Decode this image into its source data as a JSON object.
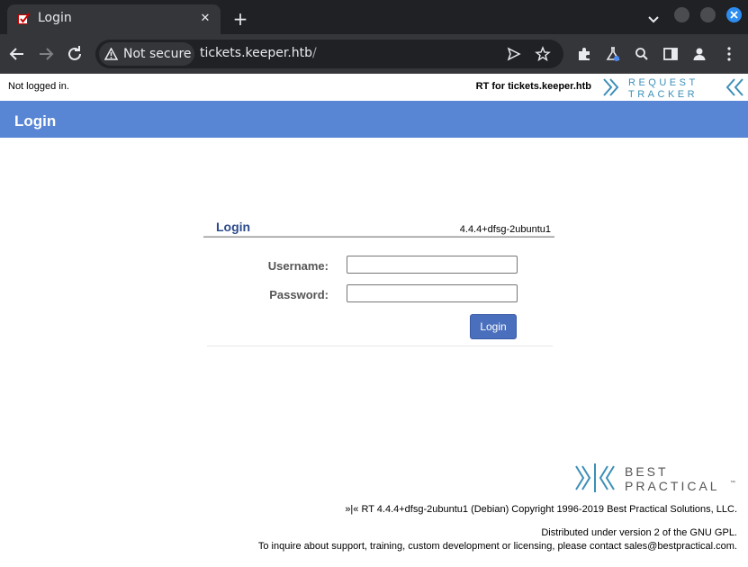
{
  "browser": {
    "tab_title": "Login",
    "security_label": "Not secure",
    "url_host": "tickets.keeper.htb",
    "url_path": "/"
  },
  "rt": {
    "not_logged_in": "Not logged in.",
    "rt_for": "RT for tickets.keeper.htb",
    "logo_line1": "REQUEST",
    "logo_line2": "TRACKER",
    "page_header": "Login",
    "login_box": {
      "title": "Login",
      "version": "4.4.4+dfsg-2ubuntu1",
      "username_label": "Username:",
      "password_label": "Password:",
      "username_value": "",
      "password_value": "",
      "submit_label": "Login"
    },
    "bp_logo": {
      "line1": "BEST",
      "line2": "PRACTICAL",
      "tm": "™"
    },
    "footer": {
      "copyright": "»|« RT 4.4.4+dfsg-2ubuntu1 (Debian) Copyright 1996-2019 Best Practical Solutions, LLC.",
      "license": "Distributed under version 2 of the GNU GPL.",
      "contact": "To inquire about support, training, custom development or licensing, please contact sales@bestpractical.com."
    }
  },
  "colors": {
    "header_bar": "#5885d4",
    "login_title": "#2c4b8a",
    "button": "#4a6fbd",
    "logo_teal": "#3c8fb8",
    "chrome_dark": "#202124",
    "chrome_toolbar": "#35363a"
  },
  "icons": {
    "tab_favicon": "rt-favicon-icon",
    "tab_close": "close-icon",
    "new_tab": "plus-icon",
    "back": "arrow-left-icon",
    "forward": "arrow-right-icon",
    "reload": "reload-icon",
    "security": "warning-triangle-icon",
    "send": "send-icon",
    "bookmark": "star-icon",
    "extensions": "puzzle-icon",
    "labs": "flask-icon",
    "search": "search-icon",
    "side_panel": "side-panel-icon",
    "profile": "person-icon",
    "menu": "kebab-menu-icon"
  }
}
